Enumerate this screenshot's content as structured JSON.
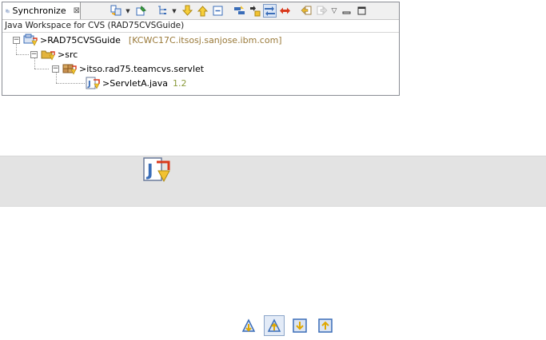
{
  "view": {
    "tab_label": "Synchronize",
    "tab_close": "⊠",
    "title": "Java Workspace for CVS (RAD75CVSGuide)",
    "dropdown_glyph": "▼",
    "menu_glyph": "▽"
  },
  "tree": {
    "project": {
      "label": ">RAD75CVSGuide",
      "host": "[KCWC17C.itsosj.sanjose.ibm.com]",
      "toggle": "−"
    },
    "folder": {
      "label": ">src",
      "toggle": "−"
    },
    "package": {
      "label": ">itso.rad75.teamcvs.servlet",
      "toggle": "−"
    },
    "file": {
      "label": ">ServletA.java",
      "revision": "1.2"
    }
  },
  "colors": {
    "accent_outgoing": "#d9391c",
    "folder_yellow": "#e3b43c",
    "arrow_yellow": "#f2c230",
    "blue": "#3a6db8",
    "band": "#e3e3e3"
  },
  "icons": {
    "toolbar": [
      "sync-icon",
      "pin-icon",
      "layout-icon",
      "next-diff-icon",
      "prev-diff-icon",
      "collapse-all-icon",
      "incoming-mode-icon",
      "outgoing-mode-icon",
      "both-mode-icon",
      "conflicts-mode-icon",
      "back-icon",
      "forward-icon"
    ],
    "nav": [
      "incoming-nav-icon",
      "outgoing-nav-icon",
      "incoming-commit-icon",
      "outgoing-commit-icon"
    ]
  }
}
